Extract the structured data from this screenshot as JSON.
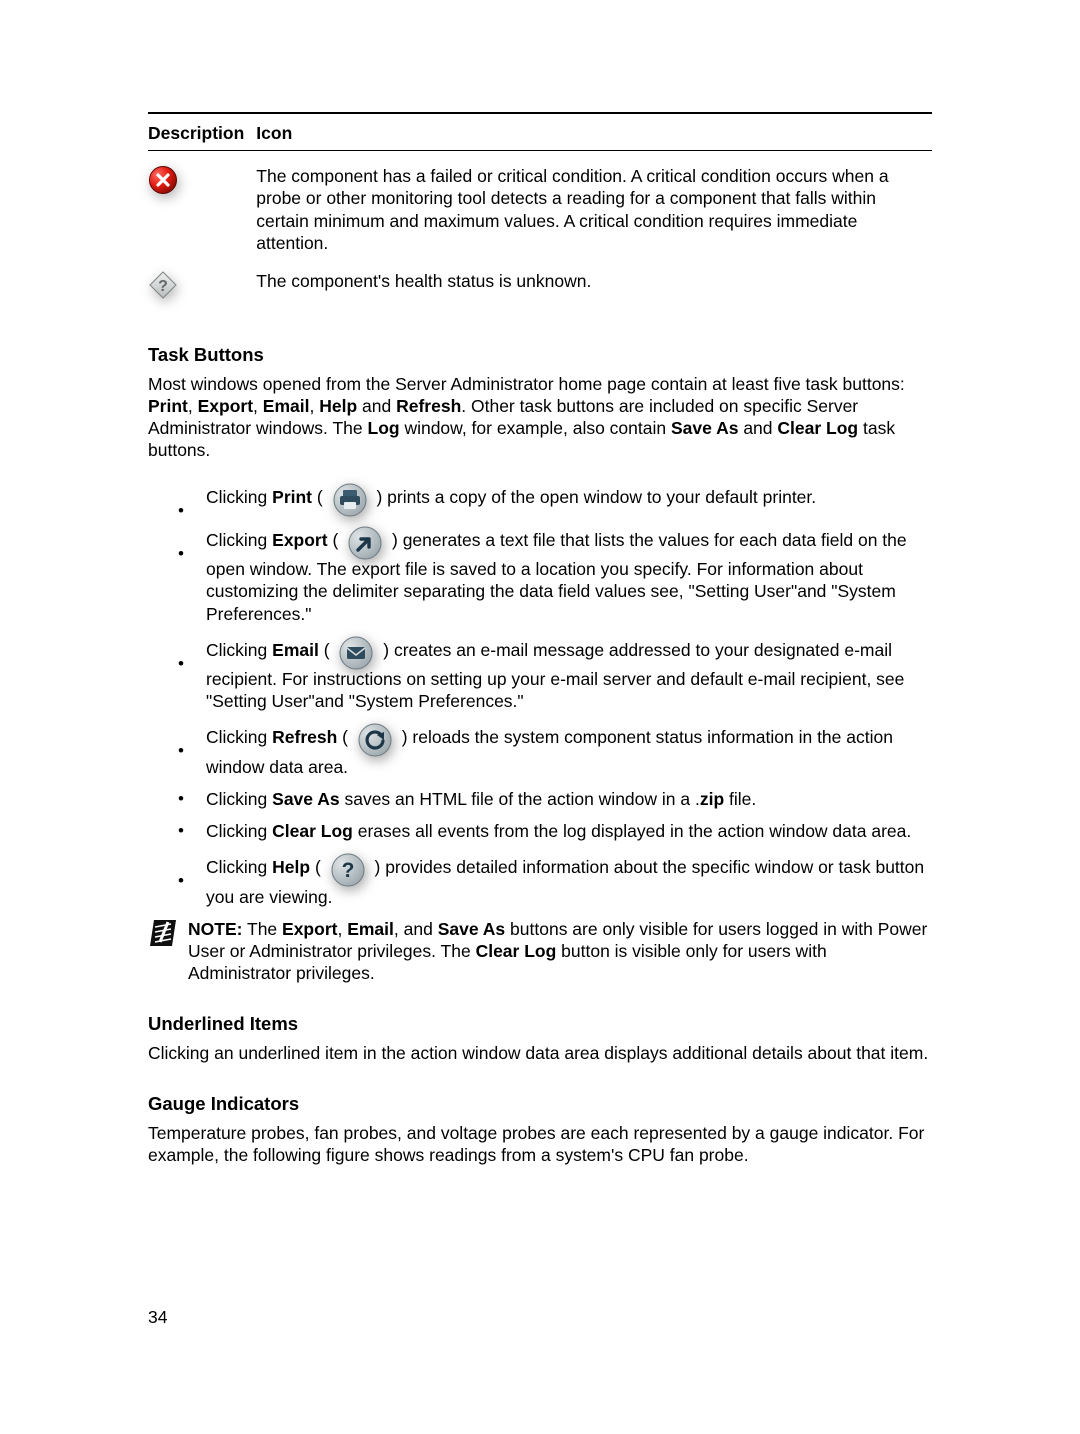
{
  "table": {
    "headers": {
      "description": "Description",
      "icon": "Icon"
    },
    "rows": [
      {
        "text": "The component has a failed or critical condition. A critical condition occurs when a probe or other monitoring tool detects a reading for a component that falls within certain minimum and maximum values. A critical condition requires immediate attention."
      },
      {
        "text": "The component's health status is unknown."
      }
    ]
  },
  "sections": {
    "task_buttons": {
      "heading": "Task Buttons",
      "intro": {
        "pre": "Most windows opened from the Server Administrator home page contain at least five task buttons: ",
        "b1": "Print",
        "c1": ", ",
        "b2": "Export",
        "c2": ", ",
        "b3": "Email",
        "c3": ", ",
        "b4": "Help",
        "and": " and ",
        "b5": "Refresh",
        "post1": ". Other task buttons are included on specific Server Administrator windows. The ",
        "b6": "Log",
        "post2": " window, for example, also contain ",
        "b7": "Save As",
        "and2": " and ",
        "b8": "Clear Log",
        "post3": " task buttons."
      },
      "items": {
        "print": {
          "pre": "Clicking ",
          "b": "Print",
          "mid": " ( ",
          "end": " ) prints a copy of the open window to your default printer."
        },
        "export_pre": "Clicking ",
        "export_b": "Export",
        "export_mid": " ( ",
        "export_end": " ) generates a text file that lists the values for each data field on the open window. The export file is saved to a location you specify. For information about customizing the delimiter separating the data field values see, \"Setting User\"and \"System Preferences.\"",
        "email_pre": "Clicking ",
        "email_b": "Email",
        "email_mid": " ( ",
        "email_end": " ) creates an e-mail message addressed to your designated e-mail recipient. For instructions on setting up your e-mail server and default e-mail recipient, see \"Setting User\"and \"System Preferences.\"",
        "refresh_pre": "Clicking ",
        "refresh_b": "Refresh",
        "refresh_mid": " ( ",
        "refresh_end": " ) reloads the system component status information in the action window data area.",
        "saveas": {
          "pre": "Clicking ",
          "b": "Save As",
          "mid": " saves an HTML file of the action window in a .",
          "b2": "zip",
          "end": " file."
        },
        "clearlog": {
          "pre": "Clicking ",
          "b": "Clear Log",
          "end": " erases all events from the log displayed in the action window data area."
        },
        "help_pre": "Clicking ",
        "help_b": "Help",
        "help_mid": " ( ",
        "help_end": " ) provides detailed information about the specific window or task button you are viewing."
      },
      "note": {
        "label": "NOTE:",
        "pre": " The ",
        "b1": "Export",
        "c1": ", ",
        "b2": "Email",
        "c2": ", and ",
        "b3": "Save As",
        "mid": " buttons are only visible for users logged in with Power User or Administrator privileges. The ",
        "b4": "Clear Log",
        "end": " button is visible only for users with Administrator privileges."
      }
    },
    "underlined": {
      "heading": "Underlined Items",
      "body": "Clicking an underlined item in the action window data area displays additional details about that item."
    },
    "gauge": {
      "heading": "Gauge Indicators",
      "body": "Temperature probes, fan probes, and voltage probes are each represented by a gauge indicator. For example, the following figure shows readings from a system's CPU fan probe."
    }
  },
  "page_number": "34"
}
